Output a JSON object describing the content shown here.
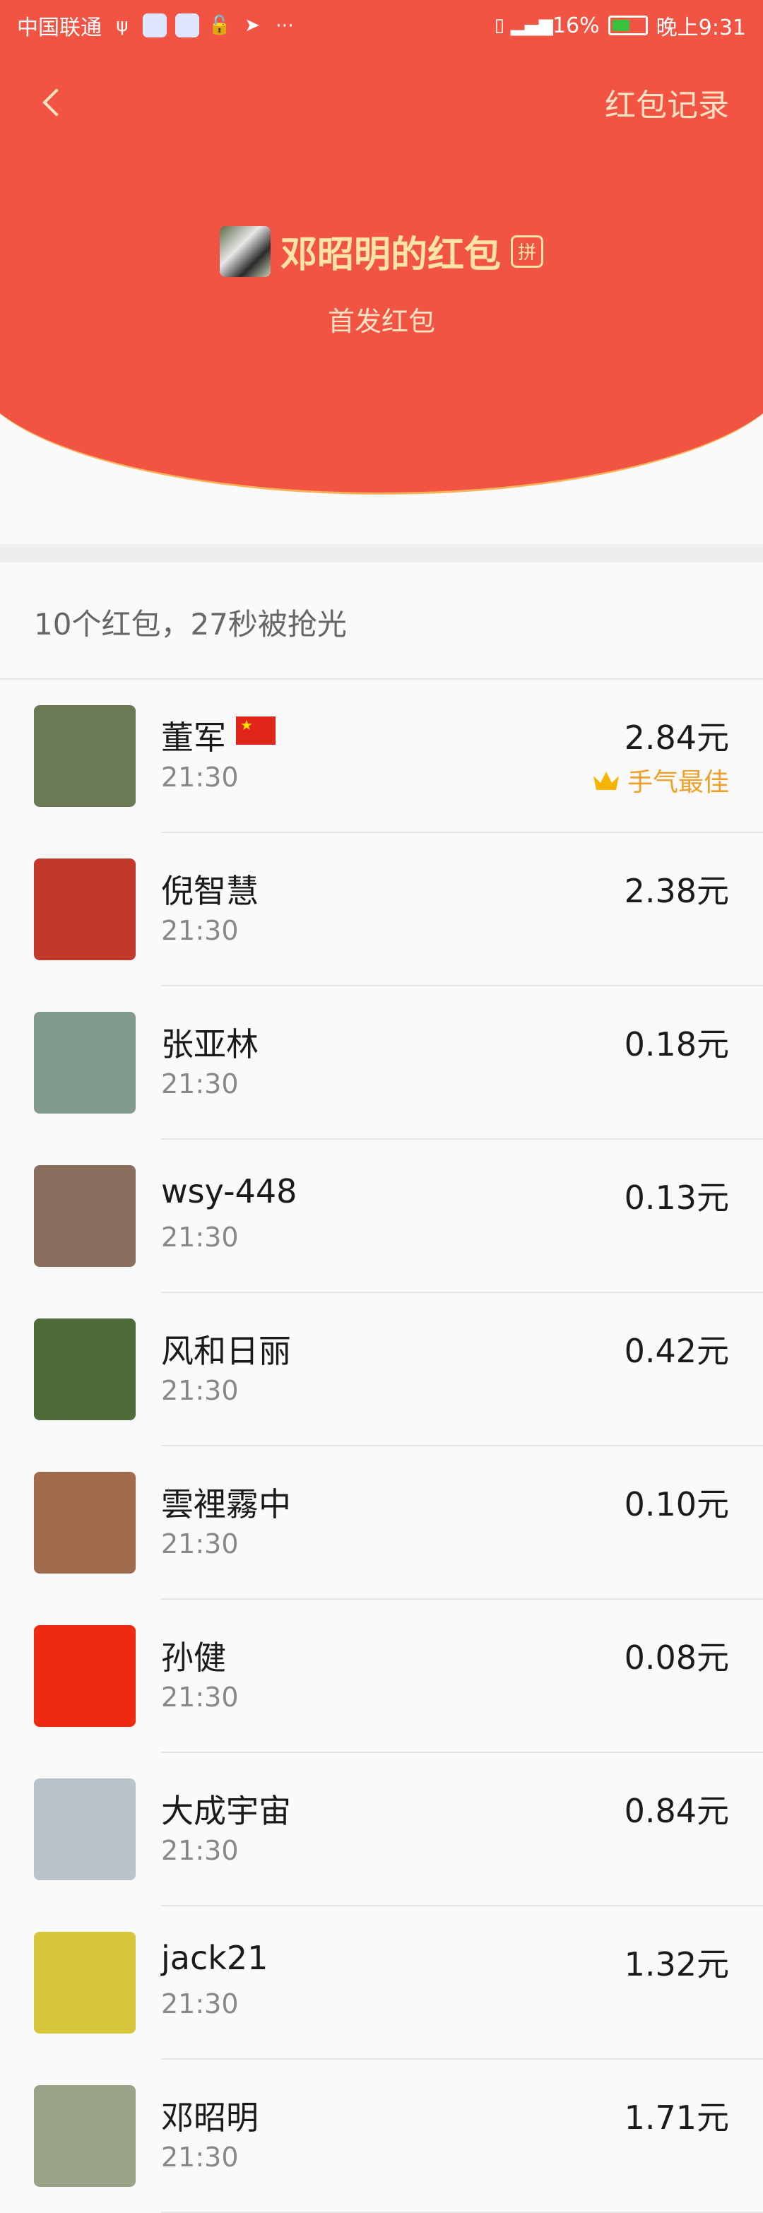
{
  "status_bar": {
    "carrier": "中国联通",
    "battery": "16%",
    "time": "晚上9:31"
  },
  "nav": {
    "records_label": "红包记录"
  },
  "sender": {
    "title": "邓昭明的红包",
    "badge": "拼",
    "subtitle": "首发红包"
  },
  "summary": "10个红包，27秒被抢光",
  "best_label": "手气最佳",
  "rows": [
    {
      "name": "董军",
      "time": "21:30",
      "amount": "2.84元",
      "best": true,
      "avatar_color": "#6b7a55"
    },
    {
      "name": "倪智慧",
      "time": "21:30",
      "amount": "2.38元",
      "avatar_color": "#c0392b"
    },
    {
      "name": "张亚林",
      "time": "21:30",
      "amount": "0.18元",
      "avatar_color": "#7f9a8a"
    },
    {
      "name": "wsy-448",
      "time": "21:30",
      "amount": "0.13元",
      "avatar_color": "#8a6f5e"
    },
    {
      "name": "风和日丽",
      "time": "21:30",
      "amount": "0.42元",
      "avatar_color": "#4f6b3a"
    },
    {
      "name": "雲裡霧中",
      "time": "21:30",
      "amount": "0.10元",
      "avatar_color": "#a06a4c"
    },
    {
      "name": "孙健",
      "time": "21:30",
      "amount": "0.08元",
      "avatar_color": "#f02a10"
    },
    {
      "name": "大成宇宙",
      "time": "21:30",
      "amount": "0.84元",
      "avatar_color": "#b9c3c8"
    },
    {
      "name": "jack21",
      "time": "21:30",
      "amount": "1.32元",
      "avatar_color": "#d8c63a"
    },
    {
      "name": "邓昭明",
      "time": "21:30",
      "amount": "1.71元",
      "avatar_color": "#9aa287"
    }
  ]
}
